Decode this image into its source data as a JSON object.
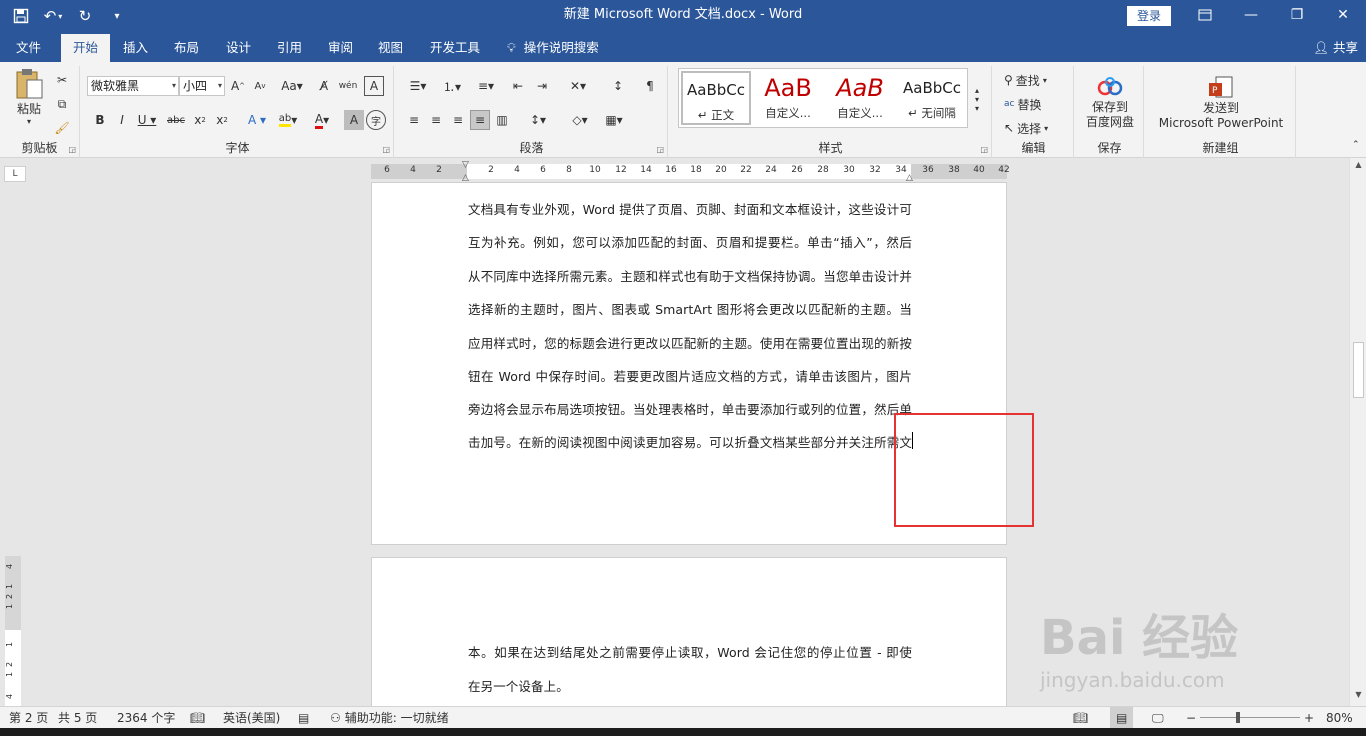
{
  "app": {
    "title": "新建 Microsoft Word 文档.docx  -  Word",
    "login_label": "登录",
    "share_label": "共享"
  },
  "tabs": [
    "文件",
    "开始",
    "插入",
    "布局",
    "设计",
    "引用",
    "审阅",
    "视图",
    "开发工具"
  ],
  "tell_me": "操作说明搜索",
  "ribbon": {
    "clipboard": {
      "paste": "粘贴",
      "label": "剪贴板"
    },
    "font": {
      "name": "微软雅黑",
      "size": "小四",
      "label": "字体"
    },
    "paragraph": {
      "label": "段落"
    },
    "styles": {
      "label": "样式",
      "items": [
        {
          "preview": "AaBbCc",
          "name": "↵ 正文"
        },
        {
          "preview": "AaB",
          "name": "自定义..."
        },
        {
          "preview": "AaB",
          "name": "自定义..."
        },
        {
          "preview": "AaBbCc",
          "name": "↵ 无间隔"
        }
      ]
    },
    "editing": {
      "find": "查找",
      "replace": "替换",
      "select": "选择",
      "label": "编辑"
    },
    "save": {
      "line1": "保存到",
      "line2": "百度网盘",
      "label": "保存"
    },
    "newgroup": {
      "line1": "发送到",
      "line2": "Microsoft PowerPoint",
      "label": "新建组"
    }
  },
  "ruler": {
    "ticks": [
      "6",
      "4",
      "2",
      "2",
      "4",
      "6",
      "8",
      "10",
      "12",
      "14",
      "16",
      "18",
      "20",
      "22",
      "24",
      "26",
      "28",
      "30",
      "32",
      "34",
      "36",
      "38",
      "40",
      "42"
    ],
    "corner": "L",
    "vticks": [
      "4",
      "1",
      "2",
      "1",
      "1",
      "2",
      "1",
      "4"
    ]
  },
  "page1_lines": [
    "文档具有专业外观，Word 提供了页眉、页脚、封面和文本框设计，这些设计可",
    "互为补充。例如，您可以添加匹配的封面、页眉和提要栏。单击“插入”，然后",
    "从不同库中选择所需元素。主题和样式也有助于文档保持协调。当您单击设计并",
    "选择新的主题时，图片、图表或 SmartArt 图形将会更改以匹配新的主题。当",
    "应用样式时，您的标题会进行更改以匹配新的主题。使用在需要位置出现的新按",
    "钮在 Word 中保存时间。若要更改图片适应文档的方式，请单击该图片，图片",
    "旁边将会显示布局选项按钮。当处理表格时，单击要添加行或列的位置，然后单",
    "击加号。在新的阅读视图中阅读更加容易。可以折叠文档某些部分并关注所需文"
  ],
  "page2_lines": [
    "本。如果在达到结尾处之前需要停止读取，Word 会记住您的停止位置 - 即使",
    "在另一个设备上。"
  ],
  "status": {
    "page": "第 2 页",
    "total_pages": "共 5 页",
    "words": "2364 个字",
    "language": "英语(美国)",
    "accessibility": "辅助功能: 一切就绪",
    "zoom": "80%"
  },
  "watermark": {
    "brand": "Bai  经验",
    "url": "jingyan.baidu.com"
  },
  "colors": {
    "accent": "#2b579a",
    "highlight": "#e53333"
  }
}
